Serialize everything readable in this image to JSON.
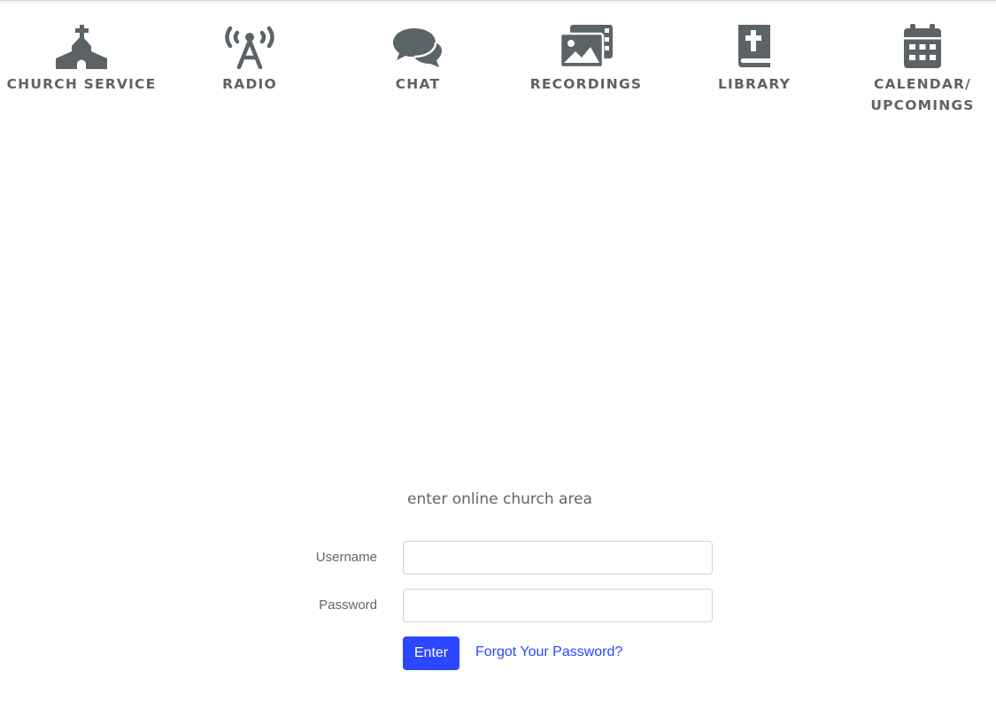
{
  "nav": {
    "items": [
      {
        "label": "CHURCH SERVICE",
        "icon": "church-icon"
      },
      {
        "label": "RADIO",
        "icon": "broadcast-tower-icon"
      },
      {
        "label": "CHAT",
        "icon": "chat-bubbles-icon"
      },
      {
        "label": "RECORDINGS",
        "icon": "photo-video-icon"
      },
      {
        "label": "LIBRARY",
        "icon": "bible-icon"
      },
      {
        "label": "CALENDAR/\nUPCOMINGS",
        "icon": "calendar-icon"
      }
    ],
    "icon_color": "#5c6367"
  },
  "login": {
    "title": "enter online church area",
    "username_label": "Username",
    "username_value": "",
    "password_label": "Password",
    "password_value": "",
    "enter_label": "Enter",
    "forgot_label": "Forgot Your Password?"
  },
  "colors": {
    "accent": "#2b47ff",
    "text": "#5f666b",
    "input_border": "#ced4da"
  }
}
